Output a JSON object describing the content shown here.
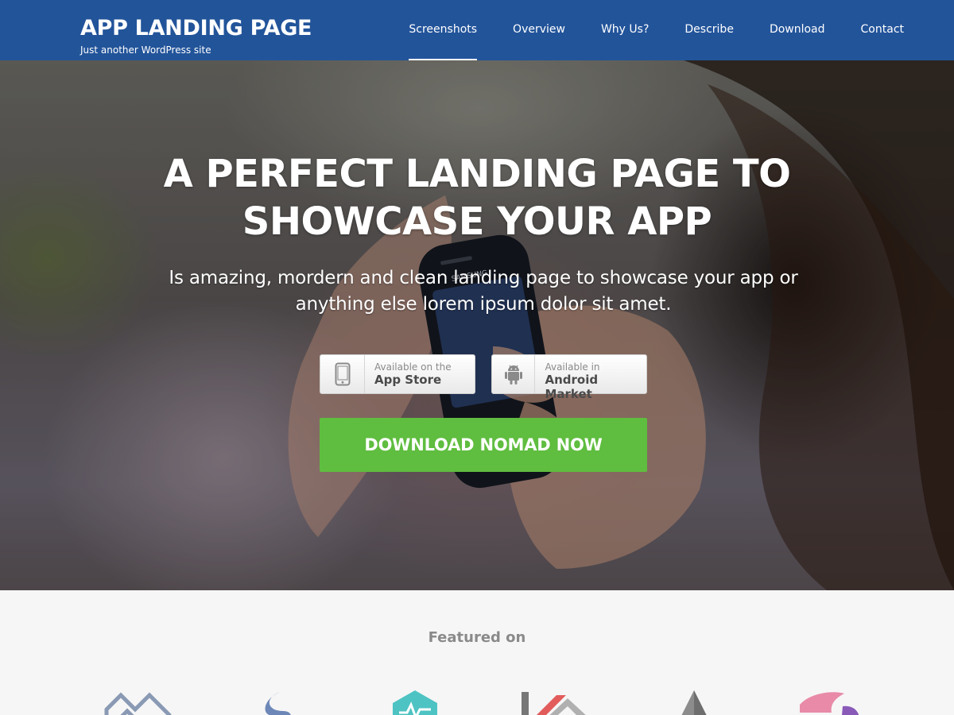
{
  "site": {
    "title": "APP LANDING PAGE",
    "tagline": "Just another WordPress site"
  },
  "nav": {
    "items": [
      {
        "label": "Screenshots",
        "active": true
      },
      {
        "label": "Overview",
        "active": false
      },
      {
        "label": "Why Us?",
        "active": false
      },
      {
        "label": "Describe",
        "active": false
      },
      {
        "label": "Download",
        "active": false
      },
      {
        "label": "Contact",
        "active": false
      }
    ]
  },
  "hero": {
    "headline_line1": "A PERFECT LANDING PAGE TO",
    "headline_line2": "SHOWCASE YOUR APP",
    "sub_line1": "Is amazing, mordern and clean landing page to showcase your app or",
    "sub_line2": "anything else lorem ipsum dolor sit amet.",
    "app_store": {
      "small": "Available on the",
      "big": "App Store",
      "icon": "smartphone-icon"
    },
    "android": {
      "small": "Available in",
      "big": "Android Market",
      "icon": "android-icon"
    },
    "cta": "DOWNLOAD NOMAD NOW",
    "phone_brand": "SAMSUNG"
  },
  "featured": {
    "title": "Featured on",
    "logos": [
      "maze-logo",
      "s-swirl-logo",
      "hexagon-wave-logo",
      "k-roof-logo",
      "triangle-logo",
      "flame-logo"
    ]
  },
  "colors": {
    "header": "#22549a",
    "cta": "#5fbd3f",
    "featured_bg": "#f6f6f6"
  }
}
